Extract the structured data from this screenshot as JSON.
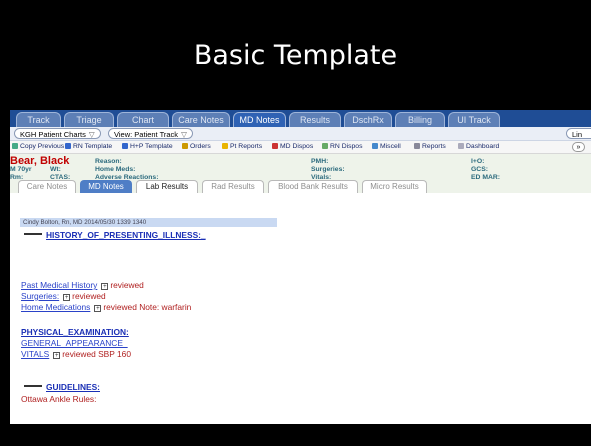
{
  "slide": {
    "title": "Basic Template"
  },
  "nav_tabs": [
    "Track",
    "Triage",
    "Chart",
    "Care Notes",
    "MD Notes",
    "Results",
    "DschRx",
    "Billing",
    "UI Track"
  ],
  "controls": {
    "charts": "KGH Patient Charts",
    "view": "View: Patient Track",
    "right": "Lin"
  },
  "toolbar": [
    "Copy Previous",
    "RN Template",
    "H+P Template",
    "Orders",
    "Pt Reports",
    "MD Dispos",
    "RN Dispos",
    "Miscell",
    "Reports",
    "Dashboard"
  ],
  "patient": {
    "name": "Bear, Black",
    "sex_age": "M  70yr",
    "wt": "Wt:",
    "rm": "Rm:",
    "ctas": "CTAS:",
    "reason": "Reason:",
    "home_meds": "Home Meds:",
    "adverse": "Adverse Reactions:",
    "pmh": "PMH:",
    "surgeries": "Surgeries:",
    "vitals": "Vitals:",
    "io": "I+O:",
    "gcs": "GCS:",
    "edmar": "ED MAR:"
  },
  "sub_tabs": [
    "Care Notes",
    "MD Notes",
    "Lab Results",
    "Rad Results",
    "Blood Bank Results",
    "Micro Results"
  ],
  "note": {
    "header": "Cindy Bolton, Rn, MD    2014/05/30 1339    1340",
    "hpi": "HISTORY_OF_PRESENTING_ILLNESS:_",
    "pmh_link": "Past Medical History",
    "pmh_val": "reviewed",
    "surg_link": "Surgeries:",
    "surg_val": "reviewed",
    "meds_link": "Home Medications",
    "meds_val": "reviewed Note: warfarin",
    "pe": "PHYSICAL_EXAMINATION:",
    "ga": "GENERAL_APPEARANCE_",
    "vitals_link": "VITALS",
    "vitals_val": "reviewed SBP 160",
    "guidelines": "GUIDELINES:",
    "ottawa": "Ottawa Ankle Rules:"
  }
}
